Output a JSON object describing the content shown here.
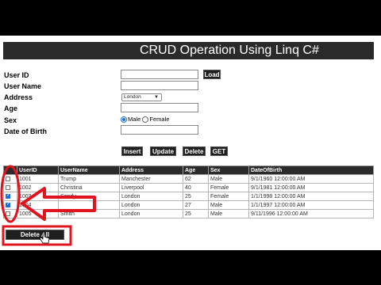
{
  "title": "CRUD Operation Using Linq C#",
  "form": {
    "user_id_label": "User ID",
    "user_name_label": "User Name",
    "address_label": "Address",
    "age_label": "Age",
    "sex_label": "Sex",
    "dob_label": "Date of Birth",
    "load_button": "Load",
    "address_selected": "London",
    "sex_options": [
      "Male",
      "Female"
    ],
    "sex_selected": "Male"
  },
  "actions": {
    "insert": "Insert",
    "update": "Update",
    "delete": "Delete",
    "get": "GET",
    "delete_all": "Delete All"
  },
  "table": {
    "headers": [
      "UserID",
      "UserName",
      "Address",
      "Age",
      "Sex",
      "DateOfBirth"
    ],
    "rows": [
      {
        "checked": false,
        "cells": [
          "1001",
          "Trump",
          "Manchester",
          "62",
          "Male",
          "9/1/1960 12:00:00 AM"
        ]
      },
      {
        "checked": false,
        "cells": [
          "1002",
          "Christina",
          "Liverpool",
          "40",
          "Female",
          "9/1/1981 12:00:00 AM"
        ]
      },
      {
        "checked": true,
        "cells": [
          "1003",
          "Sandy",
          "London",
          "25",
          "Female",
          "1/1/1998 12:00:00 AM"
        ]
      },
      {
        "checked": true,
        "cells": [
          "1004",
          "",
          "London",
          "27",
          "Male",
          "1/1/1997 12:00:00 AM"
        ]
      },
      {
        "checked": false,
        "cells": [
          "1005",
          "Smith",
          "London",
          "25",
          "Male",
          "9/11/1996 12:00:00 AM"
        ]
      }
    ]
  },
  "annotation_color": "#e0141e"
}
